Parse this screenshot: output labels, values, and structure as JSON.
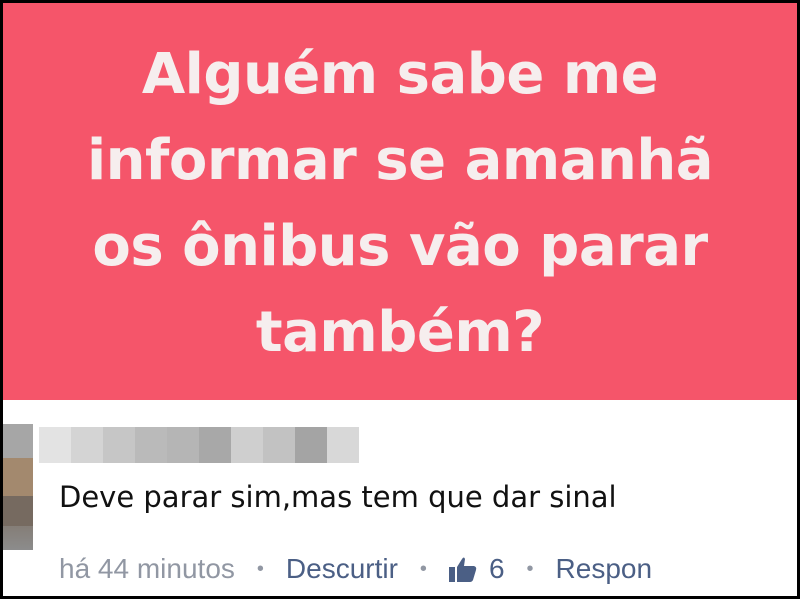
{
  "post": {
    "lines": [
      "Alguém sabe me",
      "informar se amanhã",
      "os ônibus vão parar",
      "também?"
    ],
    "background_color": "#f5556a"
  },
  "comment": {
    "text": "Deve parar sim,mas tem que dar sinal",
    "timestamp": "há 44 minutos",
    "unlike_label": "Descurtir",
    "like_count": "6",
    "reply_label": "Respon",
    "separator": "•",
    "like_icon": "thumbs-up-icon",
    "link_color": "#4b5f85"
  }
}
